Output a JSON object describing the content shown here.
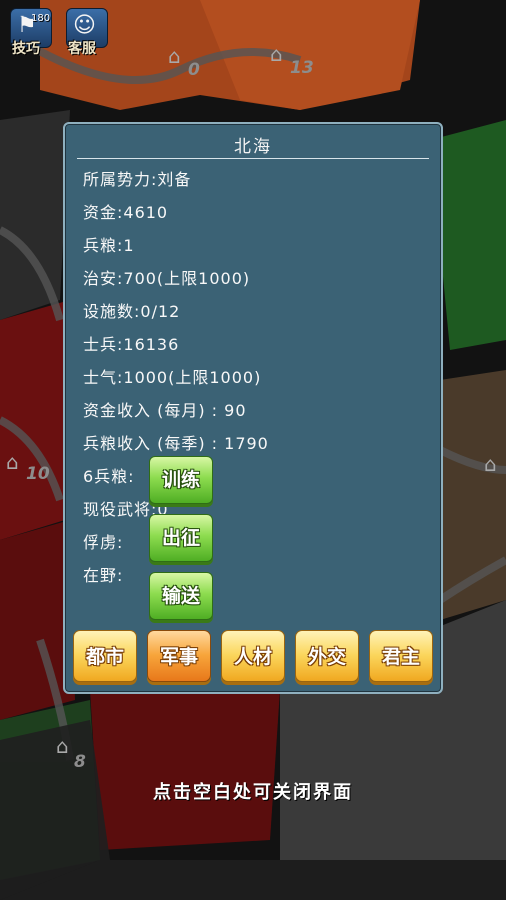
{
  "top_bar": {
    "tips": {
      "label": "技巧",
      "badge": "180"
    },
    "service": {
      "label": "客服"
    }
  },
  "map": {
    "city_numbers": [
      "0",
      "13",
      "10",
      "8"
    ]
  },
  "panel": {
    "title": "北海",
    "rows": [
      "所属势力:刘备",
      "资金:4610",
      "兵粮:1",
      "治安:700(上限1000)",
      "设施数:0/12",
      "士兵:16136",
      "士气:1000(上限1000)",
      "资金收入 (每月) : 90",
      "兵粮收入 (每季) : 1790",
      "6兵粮:",
      "现役武将:0",
      "俘虏:",
      "在野:"
    ],
    "actions": [
      "训练",
      "出征",
      "输送"
    ],
    "tabs": [
      "都市",
      "军事",
      "人材",
      "外交",
      "君主"
    ],
    "active_tab": "军事"
  },
  "hint": "点击空白处可关闭界面",
  "colors": {
    "panel_bg": "#3b6275",
    "tab_yellow": "#fbd65c",
    "tab_active": "#f7a53b",
    "action_green": "#8ddc4f"
  }
}
